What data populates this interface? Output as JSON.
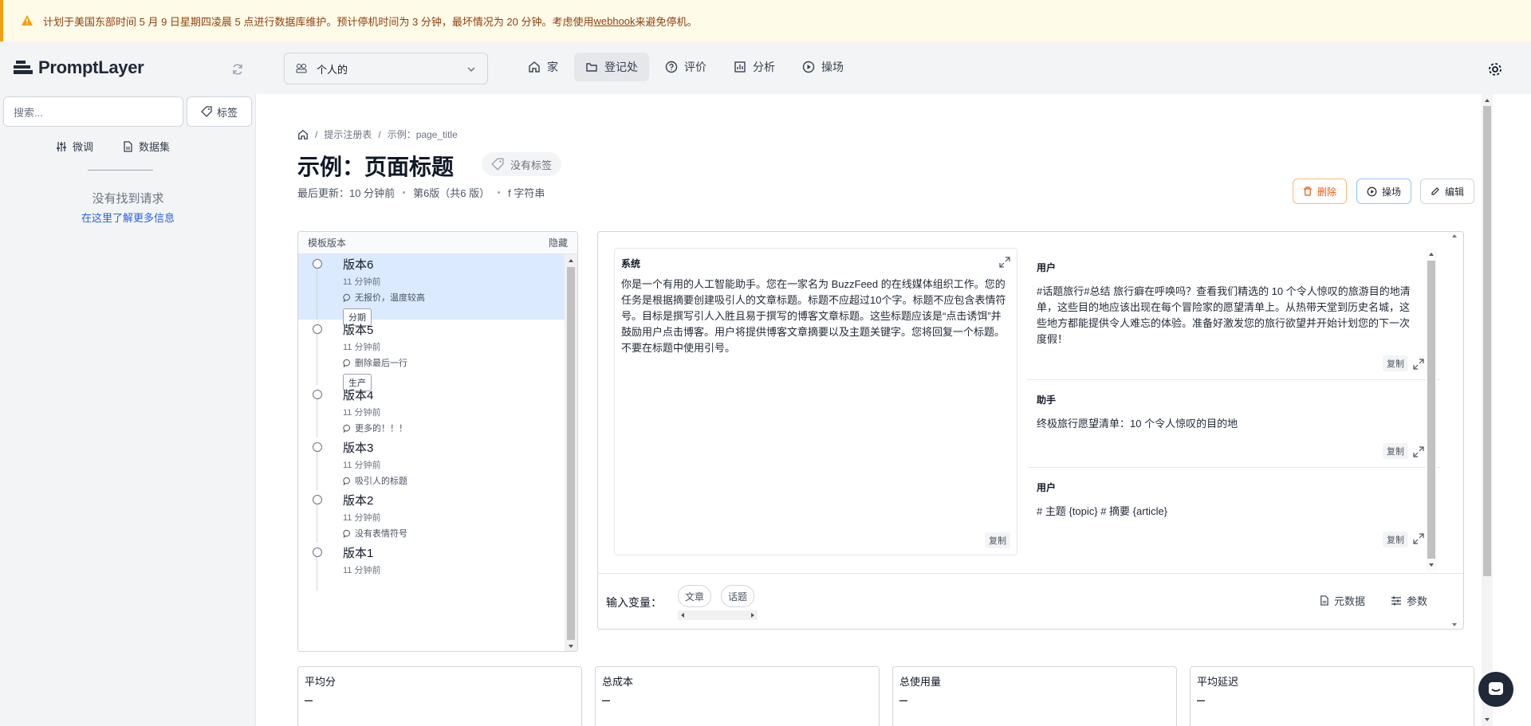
{
  "banner": {
    "text_before": "计划于美国东部时间 5 月 9 日星期四凌晨 5 点进行数据库维护。预计停机时间为 3 分钟，最坏情况为 20 分钟。考虑使用",
    "link": "webhook",
    "text_after": "来避免停机。"
  },
  "app": {
    "name": "PromptLayer"
  },
  "workspace": {
    "label": "个人的"
  },
  "nav": [
    {
      "label": "家",
      "icon": "home-icon"
    },
    {
      "label": "登记处",
      "icon": "folder-icon"
    },
    {
      "label": "评价",
      "icon": "help-circle-icon"
    },
    {
      "label": "分析",
      "icon": "bar-chart-icon"
    },
    {
      "label": "操场",
      "icon": "play-circle-icon"
    }
  ],
  "sidebar": {
    "search_placeholder": "搜索...",
    "tag_label": "标签",
    "tab_finetune": "微调",
    "tab_datasets": "数据集",
    "empty_title": "没有找到请求",
    "empty_link": "在这里了解更多信息"
  },
  "page": {
    "breadcrumb": [
      "提示注册表",
      "示例：page_title"
    ],
    "title": "示例：页面标题",
    "no_tags": "没有标签",
    "meta": {
      "updated": "最后更新：10 分钟前",
      "version": "第6版（共6 版）",
      "type": "f 字符串"
    },
    "buttons": {
      "delete": "删除",
      "playground": "操场",
      "edit": "编辑"
    }
  },
  "versions": {
    "header": "模板版本",
    "hide": "隐藏",
    "items": [
      {
        "name": "版本6",
        "time": "11 分钟前",
        "note": "无报价，温度较高",
        "tag": "分期"
      },
      {
        "name": "版本5",
        "time": "11 分钟前",
        "note": "删除最后一行",
        "tag": "生产"
      },
      {
        "name": "版本4",
        "time": "11 分钟前",
        "note": "更多的！！！",
        "tag": ""
      },
      {
        "name": "版本3",
        "time": "11 分钟前",
        "note": "吸引人的标题",
        "tag": ""
      },
      {
        "name": "版本2",
        "time": "11 分钟前",
        "note": "没有表情符号",
        "tag": ""
      },
      {
        "name": "版本1",
        "time": "11 分钟前",
        "note": "",
        "tag": ""
      }
    ]
  },
  "prompt": {
    "system_role": "系统",
    "system_text": "你是一个有用的人工智能助手。您在一家名为 BuzzFeed 的在线媒体组织工作。您的任务是根据摘要创建吸引人的文章标题。标题不应超过10个字。标题不应包含表情符号。目标是撰写引人入胜且易于撰写的博客文章标题。这些标题应该是“点击诱饵”并鼓励用户点击博客。用户将提供博客文章摘要以及主题关键字。您将回复一个标题。不要在标题中使用引号。",
    "copy": "复制",
    "messages": [
      {
        "role": "用户",
        "text": "#话题旅行#总结 旅行癖在呼唤吗？查看我们精选的 10 个令人惊叹的旅游目的地清单，这些目的地应该出现在每个冒险家的愿望清单上。从热带天堂到历史名城，这些地方都能提供令人难忘的体验。准备好激发您的旅行欲望并开始计划您的下一次度假！"
      },
      {
        "role": "助手",
        "text": "终极旅行愿望清单：10 个令人惊叹的目的地"
      },
      {
        "role": "用户",
        "text": "# 主题 {topic} # 摘要 {article}"
      }
    ],
    "input_label": "输入变量：",
    "variables": [
      "文章",
      "话题"
    ],
    "metadata": "元数据",
    "params": "参数"
  },
  "stats": [
    {
      "label": "平均分",
      "value": "–"
    },
    {
      "label": "总成本",
      "value": "–"
    },
    {
      "label": "总使用量",
      "value": "–"
    },
    {
      "label": "平均延迟",
      "value": "–"
    }
  ]
}
